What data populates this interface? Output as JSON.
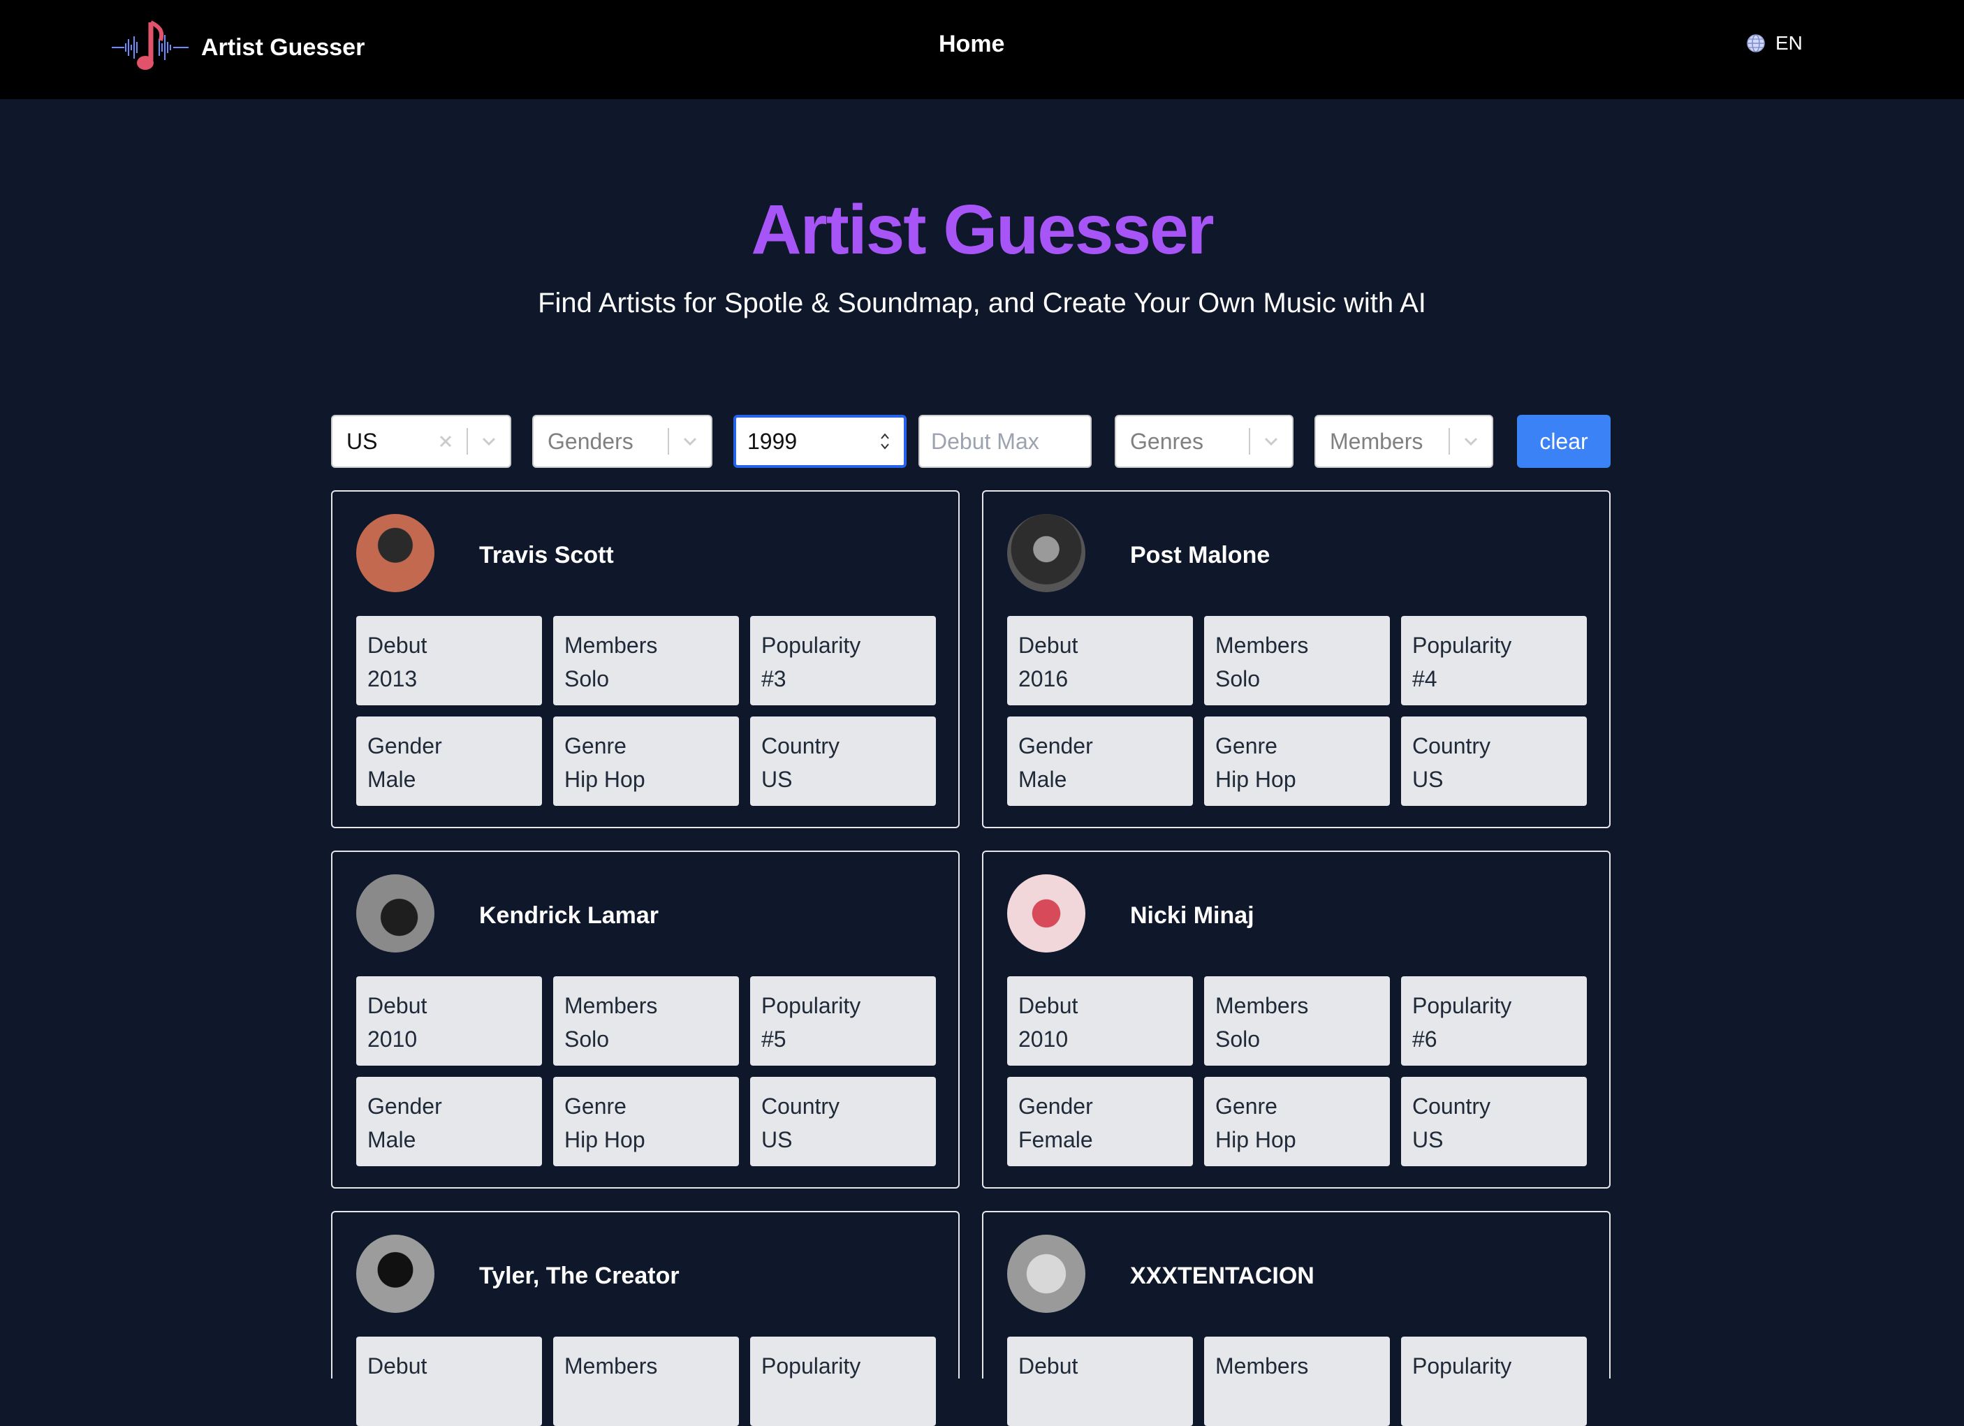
{
  "nav": {
    "brand": "Artist Guesser",
    "home": "Home",
    "lang": "EN"
  },
  "hero": {
    "title": "Artist Guesser",
    "subtitle": "Find Artists for Spotle & Soundmap, and Create Your Own Music with AI"
  },
  "filters": {
    "country": "US",
    "genders_placeholder": "Genders",
    "debut_min": "1999",
    "debut_max_placeholder": "Debut Max",
    "genres_placeholder": "Genres",
    "members_placeholder": "Members",
    "clear": "clear"
  },
  "labels": {
    "debut": "Debut",
    "members": "Members",
    "popularity": "Popularity",
    "gender": "Gender",
    "genre": "Genre",
    "country": "Country"
  },
  "artists": [
    {
      "name": "Travis Scott",
      "debut": "2013",
      "members": "Solo",
      "popularity": "#3",
      "gender": "Male",
      "genre": "Hip Hop",
      "country": "US",
      "avatar_color": "#c2694f"
    },
    {
      "name": "Post Malone",
      "debut": "2016",
      "members": "Solo",
      "popularity": "#4",
      "gender": "Male",
      "genre": "Hip Hop",
      "country": "US",
      "avatar_color": "#3a3a3a"
    },
    {
      "name": "Kendrick Lamar",
      "debut": "2010",
      "members": "Solo",
      "popularity": "#5",
      "gender": "Male",
      "genre": "Hip Hop",
      "country": "US",
      "avatar_color": "#6b6b6b"
    },
    {
      "name": "Nicki Minaj",
      "debut": "2010",
      "members": "Solo",
      "popularity": "#6",
      "gender": "Female",
      "genre": "Hip Hop",
      "country": "US",
      "avatar_color": "#d8a0a8"
    },
    {
      "name": "Tyler, The Creator",
      "avatar_color": "#4a4a4a"
    },
    {
      "name": "XXXTENTACION",
      "avatar_color": "#b0b0b0"
    }
  ],
  "colors": {
    "accent": "#a855f7",
    "button": "#3b82f6",
    "background": "#0f172a",
    "tile": "#e5e7eb"
  }
}
